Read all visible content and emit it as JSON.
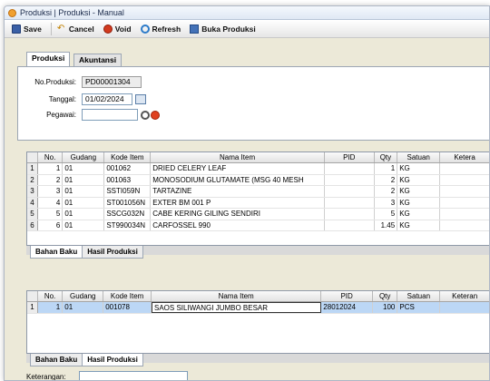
{
  "window": {
    "title": "Produksi | Produksi - Manual"
  },
  "toolbar": {
    "save": "Save",
    "cancel": "Cancel",
    "void": "Void",
    "refresh": "Refresh",
    "buka": "Buka Produksi"
  },
  "tabs": [
    "Produksi",
    "Akuntansi"
  ],
  "form": {
    "no_label": "No.Produksi:",
    "no_value": "PD00001304",
    "tanggal_label": "Tanggal:",
    "tanggal_value": "01/02/2024",
    "pegawai_label": "Pegawai:",
    "pegawai_value": ""
  },
  "grid_headers": [
    "No.",
    "Gudang",
    "Kode Item",
    "Nama Item",
    "PID",
    "Qty",
    "Satuan",
    "Keterangan"
  ],
  "grid1_headers_visible": [
    "No.",
    "Gudang",
    "Kode Item",
    "Nama Item",
    "PID",
    "Qty",
    "Satuan",
    "Ketera"
  ],
  "grid2_headers_visible": [
    "No.",
    "Gudang",
    "Kode Item",
    "Nama Item",
    "PID",
    "Qty",
    "Satuan",
    "Keteran"
  ],
  "bahan_baku": [
    {
      "rh": "1",
      "no": "1",
      "gudang": "01",
      "kode": "001062",
      "nama": "DRIED CELERY LEAF",
      "pid": "",
      "qty": "1",
      "satuan": "KG",
      "ket": ""
    },
    {
      "rh": "2",
      "no": "2",
      "gudang": "01",
      "kode": "001063",
      "nama": "MONOSODIUM GLUTAMATE (MSG 40 MESH",
      "pid": "",
      "qty": "2",
      "satuan": "KG",
      "ket": ""
    },
    {
      "rh": "3",
      "no": "3",
      "gudang": "01",
      "kode": "SSTI059N",
      "nama": "TARTAZINE",
      "pid": "",
      "qty": "2",
      "satuan": "KG",
      "ket": ""
    },
    {
      "rh": "4",
      "no": "4",
      "gudang": "01",
      "kode": "ST001056N",
      "nama": "EXTER BM 001 P",
      "pid": "",
      "qty": "3",
      "satuan": "KG",
      "ket": ""
    },
    {
      "rh": "5",
      "no": "5",
      "gudang": "01",
      "kode": "SSCG032N",
      "nama": "CABE KERING GILING SENDIRI",
      "pid": "",
      "qty": "5",
      "satuan": "KG",
      "ket": ""
    },
    {
      "rh": "6",
      "no": "6",
      "gudang": "01",
      "kode": "ST990034N",
      "nama": "CARFOSSEL 990",
      "pid": "",
      "qty": "1.45",
      "satuan": "KG",
      "ket": ""
    }
  ],
  "subtabs1": [
    "Bahan Baku",
    "Hasil Produksi"
  ],
  "hasil_produksi": [
    {
      "rh": "1",
      "no": "1",
      "gudang": "01",
      "kode": "001078",
      "nama": "SAOS SILIWANGI JUMBO BESAR",
      "pid": "28012024",
      "qty": "100",
      "satuan": "PCS",
      "ket": ""
    }
  ],
  "subtabs2": [
    "Bahan Baku",
    "Hasil Produksi"
  ],
  "keterangan": {
    "label": "Keterangan:",
    "value": ""
  }
}
